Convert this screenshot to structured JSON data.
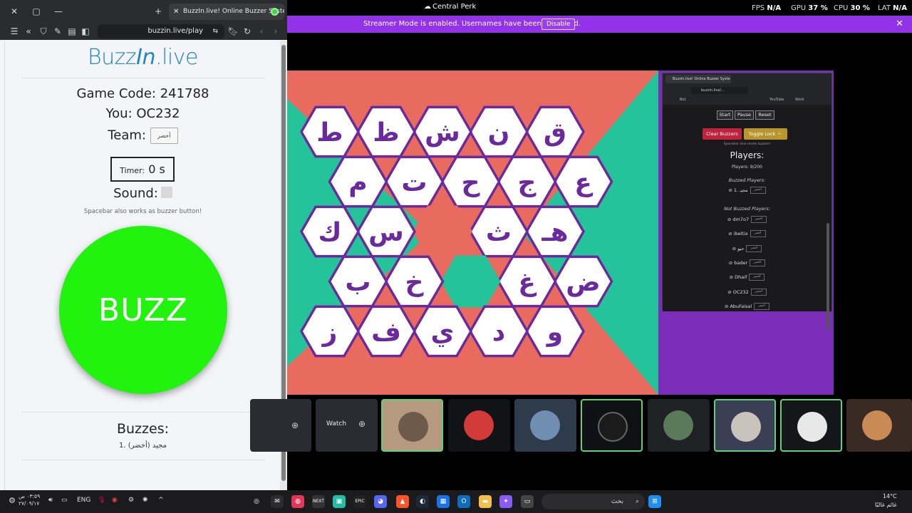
{
  "browser": {
    "tab_title": "BuzzIn.live! Online Buzzer Systen",
    "url": "buzzin.live/play"
  },
  "app": {
    "logo_part1": "Buzz",
    "logo_part2": "In",
    "logo_part3": ".live",
    "game_code_label": "Game Code: 241788",
    "you_label": "You: OC232",
    "team_label": "Team:",
    "team_button": "أخضر",
    "timer_label": "Timer:",
    "timer_value": "0 s",
    "sound_label": "Sound:",
    "hint": "Spacebar also works as buzzer button!",
    "buzz_button": "BUZZ",
    "buzzes_title": "Buzzes:",
    "buzzes": [
      "1. مجيد (أخضر)"
    ]
  },
  "topbar": {
    "window_title": "Central Perk",
    "fps_label": "FPS",
    "fps_value": "N/A",
    "gpu_label": "GPU",
    "gpu_value": "37 %",
    "cpu_label": "CPU",
    "cpu_value": "30 %",
    "lat_label": "LAT",
    "lat_value": "N/A"
  },
  "banner": {
    "message": "Streamer Mode is enabled. Usernames have been truncated.",
    "disable": "Disable"
  },
  "board": {
    "rows": [
      [
        "ق",
        "ن",
        "ش",
        "ظ",
        "ط"
      ],
      [
        "ع",
        "ج",
        "ح",
        "ت",
        "م"
      ],
      [
        "هـ",
        "ث",
        "",
        "س",
        "ك"
      ],
      [
        "ض",
        "غ",
        "",
        "خ",
        "ب"
      ],
      [
        "و",
        "د",
        "ي",
        "ف",
        "ز"
      ]
    ],
    "colors": {
      "hex_fill": "#ffffff",
      "hex_border": "#6a2a9b",
      "letter": "#6a2a9b",
      "red": "#e96a5e",
      "teal": "#25c39a"
    }
  },
  "inner_window": {
    "tab_title": "BuzzIn.live! Online Buzzer Syste",
    "url": "buzzin.live/...",
    "bookmark_1": "Bot",
    "bookmark_2": "YouTube",
    "bookmark_3": "Work",
    "start": "Start",
    "pause": "Pause",
    "reset": "Reset",
    "clear_buzzers": "Clear Buzzers",
    "toggle_lock": "Toggle Lock 🔓",
    "spacebar_note": "Spacebar also resets buzzers",
    "players_title": "Players:",
    "players_count": "Players: 9/200",
    "buzzed_title": "Buzzed Players:",
    "buzzed": [
      {
        "name": "1. مجيـ",
        "team": "أخضر"
      }
    ],
    "not_buzzed_title": "Not Buzzed Players:",
    "not_buzzed": [
      {
        "name": "dm7o7",
        "team": "أخضر"
      },
      {
        "name": "ibeltix",
        "team": "أحمر"
      },
      {
        "name": "حيو",
        "team": "أحمر"
      },
      {
        "name": "bader",
        "team": "أخضر"
      },
      {
        "name": "Dhaif",
        "team": "أخضر"
      },
      {
        "name": "OC232",
        "team": "أخضر"
      },
      {
        "name": "AbuFaisal",
        "team": "أحمر"
      }
    ]
  },
  "strip": {
    "watch": "Watch"
  },
  "taskbar": {
    "search_placeholder": "بحث",
    "lang": "ENG",
    "time": "٠٣:٥٩ ص",
    "date": "٢٧/٠٩/١٧",
    "temp": "14°C",
    "weather": "غائم غالبًا"
  }
}
